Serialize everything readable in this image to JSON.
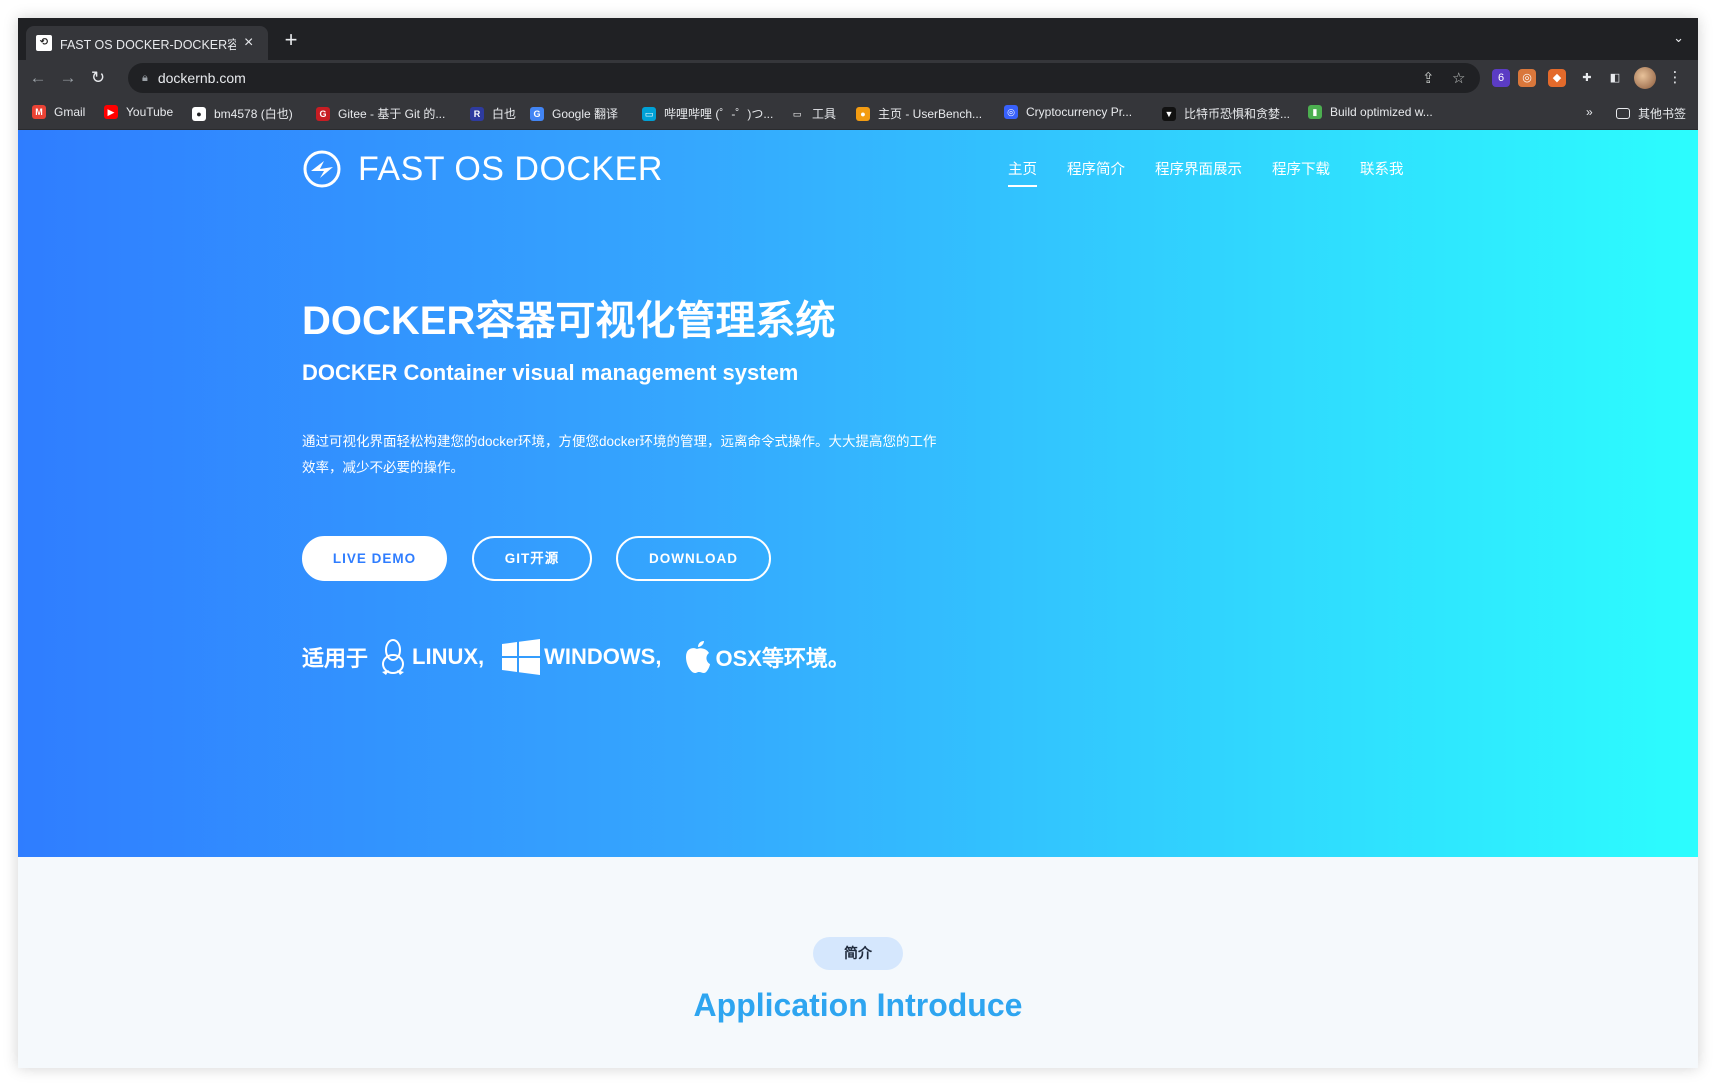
{
  "browser": {
    "tab_title": "FAST OS DOCKER-DOCKER容器",
    "tab_close": "×",
    "new_tab": "+",
    "tab_search": "⌄",
    "url": "dockernb.com",
    "ext_badge": "6"
  },
  "bookmarks": [
    {
      "label": "Gmail",
      "icon": "gmail-icon",
      "color": "#ea4335",
      "glyph": "M"
    },
    {
      "label": "YouTube",
      "icon": "youtube-icon",
      "color": "#ff0000",
      "glyph": "▶"
    },
    {
      "label": "bm4578 (白也)",
      "icon": "github-icon",
      "color": "#ffffff",
      "glyph": "●"
    },
    {
      "label": "Gitee - 基于 Git 的...",
      "icon": "gitee-icon",
      "color": "#c71d23",
      "glyph": "G"
    },
    {
      "label": "白也",
      "icon": "r-icon",
      "color": "#2e3b9f",
      "glyph": "R"
    },
    {
      "label": "Google 翻译",
      "icon": "google-translate-icon",
      "color": "#4285f4",
      "glyph": "G"
    },
    {
      "label": "哔哩哔哩 (゜-゜)つ...",
      "icon": "bilibili-icon",
      "color": "#00a1d6",
      "glyph": "▭"
    },
    {
      "label": "工具",
      "icon": "folder-icon",
      "color": "#35363a",
      "glyph": "▭"
    },
    {
      "label": "主页 - UserBench...",
      "icon": "userbenchmark-icon",
      "color": "#f39c12",
      "glyph": "●"
    },
    {
      "label": "Cryptocurrency Pr...",
      "icon": "coinmarketcap-icon",
      "color": "#3861fb",
      "glyph": "◎"
    },
    {
      "label": "比特币恐惧和贪婪...",
      "icon": "alternative-icon",
      "color": "#111111",
      "glyph": "▼"
    },
    {
      "label": "Build optimized w...",
      "icon": "build-icon",
      "color": "#4caf50",
      "glyph": "▮"
    }
  ],
  "bookmarks_more": "»",
  "other_bookmarks": "其他书签",
  "site": {
    "logo_text": "FAST OS DOCKER",
    "menu": [
      "主页",
      "程序简介",
      "程序界面展示",
      "程序下载",
      "联系我"
    ],
    "hero_title": "DOCKER容器可视化管理系统",
    "hero_subtitle": "DOCKER Container visual management system",
    "hero_description": "通过可视化界面轻松构建您的docker环境，方便您docker环境的管理，远离命令式操作。大大提高您的工作效率，减少不必要的操作。",
    "buttons": {
      "demo": "LIVE DEMO",
      "git": "GIT开源",
      "download": "DOWNLOAD"
    },
    "os_prefix": "适用于",
    "os_linux": "LINUX,",
    "os_windows": "WINDOWS,",
    "os_osx": "OSX等环境。",
    "intro_pill": "简介",
    "intro_title": "Application Introduce"
  }
}
